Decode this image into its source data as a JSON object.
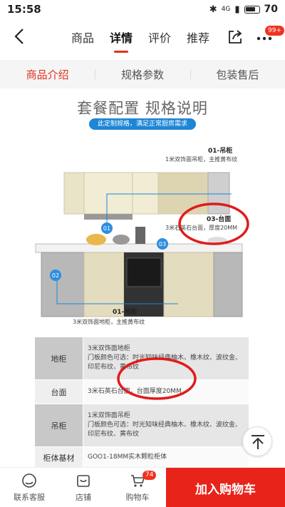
{
  "status": {
    "time": "15:58",
    "network": "4G",
    "battery": "70"
  },
  "nav": {
    "tabs": [
      "商品",
      "详情",
      "评价",
      "推荐"
    ],
    "active_tab": "详情",
    "more_badge": "99+"
  },
  "subtabs": [
    "商品介绍",
    "规格参数",
    "包装售后"
  ],
  "content": {
    "title": "套餐配置 规格说明",
    "ribbon": "此定制规格，满足正常厨房需求",
    "callouts": {
      "c1_title": "01-吊柜",
      "c1_text": "1米双饰面吊柜，主推黄布纹",
      "c2_title": "03-台面",
      "c2_text": "3米石英石台面，厚度20MM",
      "c3_title": "01-地柜",
      "c3_text": "3米双饰面地柜，主推黄布纹"
    },
    "markers": [
      "01",
      "02",
      "03"
    ]
  },
  "spec": [
    {
      "k": "地柜",
      "v": "3米双饰面地柜\n门板颜色可选：时光知味经典柚木、橡木纹、波纹金、\n印尼布纹、黄布纹"
    },
    {
      "k": "台面",
      "v": "3米石英石台面，台面厚度20MM"
    },
    {
      "k": "吊柜",
      "v": "1米双饰面吊柜\n门板颜色可选：时光知味经典柚木、橡木纹、波纹金、\n印尼布纹、黄布纹"
    },
    {
      "k": "柜体基材",
      "v": "GOO1-18MM实木颗粒柜体"
    }
  ],
  "bottom": {
    "service": "联系客服",
    "shop": "店铺",
    "cart": "购物车",
    "cart_badge": "74",
    "buy": "加入购物车"
  },
  "colors": {
    "accent": "#e0321e",
    "ribbon": "#1e86d6"
  }
}
